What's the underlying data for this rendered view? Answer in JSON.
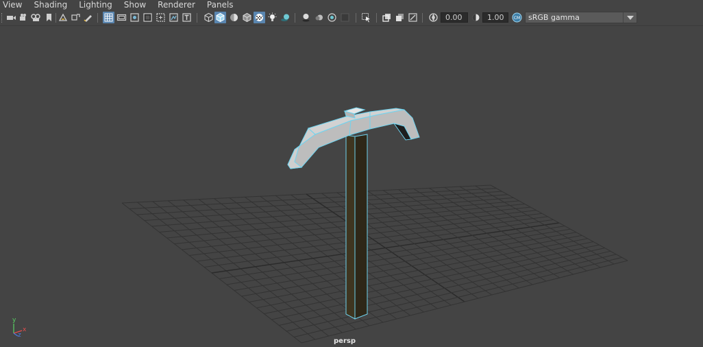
{
  "menubar": {
    "items": [
      {
        "id": "view",
        "label": "View"
      },
      {
        "id": "shading",
        "label": "Shading"
      },
      {
        "id": "lighting",
        "label": "Lighting"
      },
      {
        "id": "show",
        "label": "Show"
      },
      {
        "id": "renderer",
        "label": "Renderer"
      },
      {
        "id": "panels",
        "label": "Panels"
      }
    ]
  },
  "toolbar": {
    "exposure_value": "0.00",
    "gamma_value": "1.00",
    "colorspace_label": "sRGB gamma",
    "colorspace_badge_icon": "color-management-icon"
  },
  "viewport": {
    "camera_label": "persp",
    "axis_y": "y",
    "axis_z": "z",
    "axis_x": "x"
  },
  "colors": {
    "background": "#444444",
    "grid": "#333333",
    "selection_highlight": "#6fd4f0",
    "pick_head": "#c9c9c9",
    "pick_handle": "#3e3520",
    "active_toggle": "#5a86b0"
  }
}
